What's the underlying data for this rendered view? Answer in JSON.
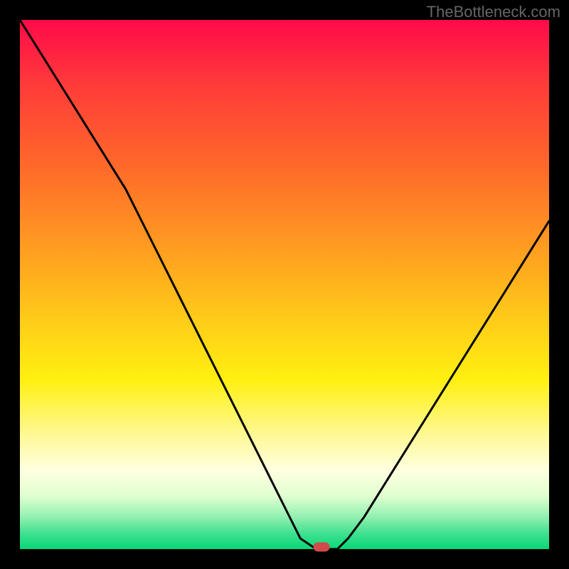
{
  "watermark": "TheBottleneck.com",
  "chart_data": {
    "type": "line",
    "title": "",
    "xlabel": "",
    "ylabel": "",
    "xlim": [
      0,
      100
    ],
    "ylim": [
      0,
      100
    ],
    "x": [
      0,
      5,
      10,
      15,
      20,
      25,
      30,
      35,
      40,
      45,
      50,
      53,
      56,
      58,
      60,
      62,
      65,
      70,
      75,
      80,
      85,
      90,
      95,
      100
    ],
    "y": [
      100,
      92,
      84,
      76,
      68,
      58,
      48,
      38,
      28,
      18,
      8,
      2,
      0,
      0,
      0,
      2,
      6,
      14,
      22,
      30,
      38,
      46,
      54,
      62
    ],
    "marker": {
      "x": 57,
      "y": 0
    },
    "gradient_stops": [
      {
        "pct": 0,
        "color": "#ff0a4a"
      },
      {
        "pct": 12,
        "color": "#ff3a3a"
      },
      {
        "pct": 28,
        "color": "#ff6a2a"
      },
      {
        "pct": 44,
        "color": "#ffa020"
      },
      {
        "pct": 58,
        "color": "#ffd018"
      },
      {
        "pct": 68,
        "color": "#fff010"
      },
      {
        "pct": 78,
        "color": "#fff890"
      },
      {
        "pct": 85,
        "color": "#ffffe0"
      },
      {
        "pct": 90,
        "color": "#e0ffd0"
      },
      {
        "pct": 94,
        "color": "#90f0b0"
      },
      {
        "pct": 97,
        "color": "#40e090"
      },
      {
        "pct": 100,
        "color": "#08d877"
      }
    ]
  }
}
